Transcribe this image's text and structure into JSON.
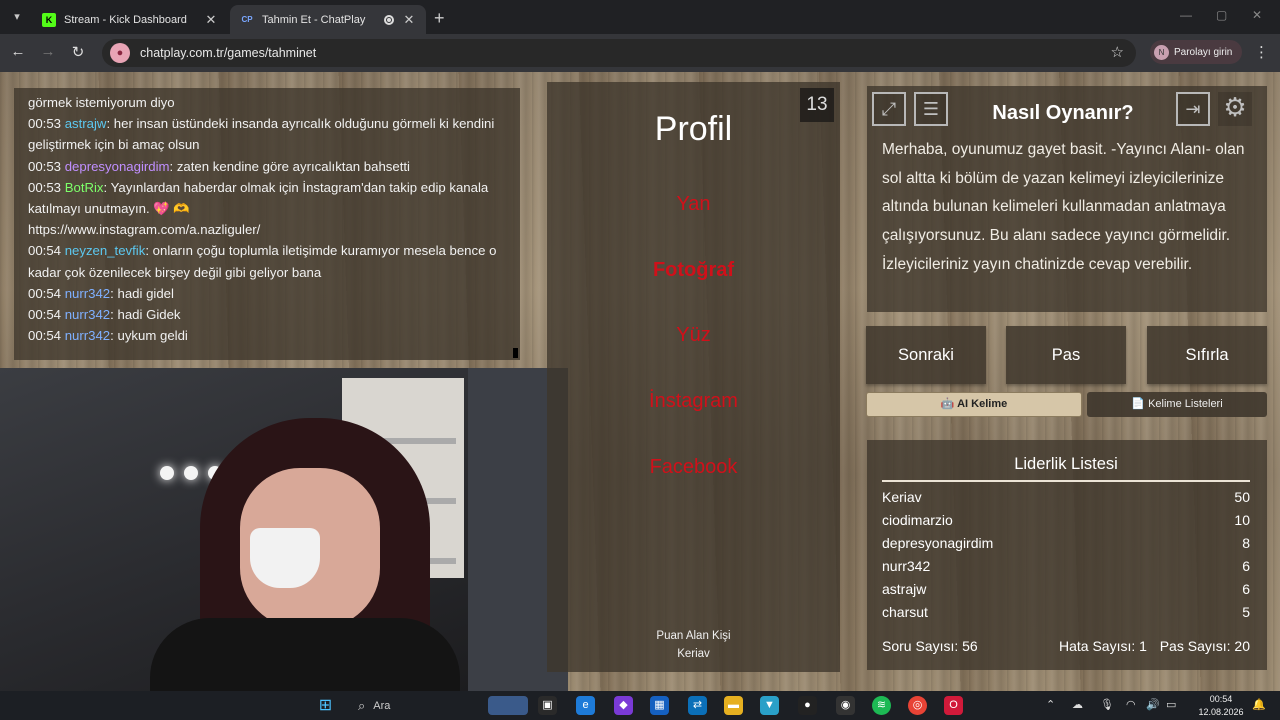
{
  "browser": {
    "tabs": [
      {
        "title": "Stream - Kick Dashboard",
        "favicon": "K"
      },
      {
        "title": "Tahmin Et - ChatPlay",
        "favicon": "CP"
      }
    ],
    "url": "chatplay.com.tr/games/tahminet",
    "password_button": "Parolayı girin",
    "profile_initial": "N"
  },
  "chat": {
    "lines": [
      {
        "time": "",
        "user": "",
        "text": "görmek istemiyorum diyo"
      },
      {
        "time": "00:53",
        "user": "astrajw",
        "text": ": her insan üstündeki insanda ayrıcalık olduğunu görmeli ki kendini geliştirmek için bi amaç olsun"
      },
      {
        "time": "00:53",
        "user": "depresyonagirdim",
        "text": ": zaten kendine göre ayrıcalıktan bahsetti"
      },
      {
        "time": "00:53",
        "user": "BotRix",
        "text": ": Yayınlardan haberdar olmak için İnstagram'dan takip edip kanala katılmayı unutmayın. 💖 🫶"
      },
      {
        "time": "",
        "user": "",
        "text": "https://www.instagram.com/a.nazliguler/"
      },
      {
        "time": "00:54",
        "user": "neyzen_tevfik",
        "text": ": onların çoğu toplumla iletişimde kuramıyor mesela bence o kadar çok özenilecek birşey değil gibi geliyor bana"
      },
      {
        "time": "00:54",
        "user": "nurr342",
        "text": ": hadi gidel"
      },
      {
        "time": "00:54",
        "user": "nurr342",
        "text": ": hadi Gidek"
      },
      {
        "time": "00:54",
        "user": "nurr342",
        "text": ": uykum geldi"
      }
    ]
  },
  "game": {
    "remaining": "13",
    "main_word": "Profil",
    "forbidden_words": [
      "Yan",
      "Fotoğraf",
      "Yüz",
      "İnstagram",
      "Facebook"
    ],
    "scorer_label": "Puan Alan Kişi",
    "scorer_name": "Keriav"
  },
  "howto": {
    "title": "Nasıl Oynanır?",
    "text": "Merhaba, oyunumuz gayet basit. -Yayıncı Alanı- olan sol altta ki bölüm de yazan kelimeyi izleyicilerinize altında bulunan kelimeleri kullanmadan anlatmaya çalışıyorsunuz. Bu alanı sadece yayıncı görmelidir. İzleyicileriniz yayın chatinizde cevap verebilir."
  },
  "controls": {
    "next": "Sonraki",
    "pass": "Pas",
    "reset": "Sıfırla",
    "ai_words": "🤖 AI Kelime",
    "word_lists": "📄 Kelime Listeleri"
  },
  "leaderboard": {
    "title": "Liderlik Listesi",
    "rows": [
      {
        "name": "Keriav",
        "score": "50"
      },
      {
        "name": "ciodimarzio",
        "score": "10"
      },
      {
        "name": "depresyonagirdim",
        "score": "8"
      },
      {
        "name": "nurr342",
        "score": "6"
      },
      {
        "name": "astrajw",
        "score": "6"
      },
      {
        "name": "charsut",
        "score": "5"
      }
    ],
    "questions": "Soru Sayısı: 56",
    "errors": "Hata Sayısı: 1",
    "passes": "Pas Sayısı: 20"
  },
  "taskbar": {
    "search_placeholder": "Ara",
    "time": "00:54",
    "date": "12.08.2026"
  },
  "colors": {
    "forbidden": "#d0101a",
    "user_blue": "#7fb0ff",
    "user_purple": "#c08fff",
    "user_green": "#7dff6a"
  }
}
